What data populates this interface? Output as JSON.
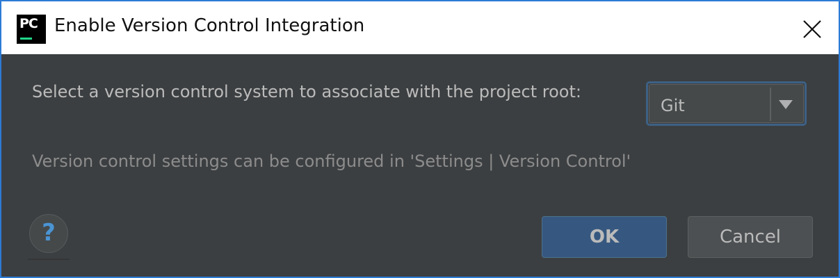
{
  "window": {
    "title": "Enable Version Control Integration",
    "app_icon_text": "PC",
    "app_icon_name": "pycharm-icon",
    "close_icon_name": "close-icon"
  },
  "body": {
    "prompt": "Select a version control system to associate with the project root:",
    "vcs_select": {
      "value": "Git",
      "arrow_icon_name": "dropdown-arrow-icon"
    },
    "info": "Version control settings can be configured in 'Settings | Version Control'"
  },
  "footer": {
    "help_label": "?",
    "ok_label": "OK",
    "cancel_label": "Cancel"
  },
  "colors": {
    "background": "#3c3f41",
    "text": "#bbbbbb",
    "muted_text": "#8c8c8c",
    "ok_button": "#365880",
    "cancel_button": "#4c5052",
    "focus_border": "#3d6185",
    "window_border": "#2d7bd6",
    "help_icon": "#4a94d3",
    "icon_accent": "#21d789"
  }
}
